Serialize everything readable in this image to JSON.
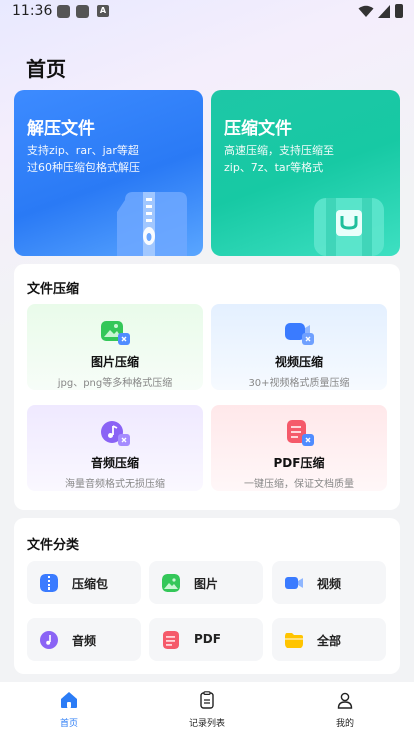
{
  "status_bar": {
    "time": "11:36",
    "notif_a": "A"
  },
  "page": {
    "title": "首页"
  },
  "hero_cards": [
    {
      "title": "解压文件",
      "desc_line1": "支持zip、rar、jar等超",
      "desc_line2": "过60种压缩包格式解压",
      "color": "#2a7af5"
    },
    {
      "title": "压缩文件",
      "desc_line1": "高速压缩，支持压缩至",
      "desc_line2": "zip、7z、tar等格式",
      "color": "#17c9a4"
    }
  ],
  "compress_section": {
    "title": "文件压缩",
    "tiles": [
      {
        "name": "图片压缩",
        "desc": "jpg、png等多种格式压缩",
        "icon": "image-compress-icon",
        "color": "#34c759"
      },
      {
        "name": "视频压缩",
        "desc": "30+视频格式质量压缩",
        "icon": "video-compress-icon",
        "color": "#3a7bff"
      },
      {
        "name": "音频压缩",
        "desc": "海量音频格式无损压缩",
        "icon": "audio-compress-icon",
        "color": "#8a63f5"
      },
      {
        "name": "PDF压缩",
        "desc": "一键压缩，保证文档质量",
        "icon": "pdf-compress-icon",
        "color": "#f55a6a"
      }
    ]
  },
  "category_section": {
    "title": "文件分类",
    "items": [
      {
        "label": "压缩包",
        "icon": "archive-icon",
        "color": "#3a7bff"
      },
      {
        "label": "图片",
        "icon": "image-icon",
        "color": "#34c759"
      },
      {
        "label": "视频",
        "icon": "video-icon",
        "color": "#3a7bff"
      },
      {
        "label": "音频",
        "icon": "audio-icon",
        "color": "#8a63f5"
      },
      {
        "label": "PDF",
        "icon": "pdf-icon",
        "color": "#f55a6a"
      },
      {
        "label": "全部",
        "icon": "folder-icon",
        "color": "#ffc400"
      }
    ]
  },
  "bottom_nav": {
    "active_color": "#2b7cf6",
    "items": [
      {
        "label": "首页",
        "icon": "home-icon",
        "active": true
      },
      {
        "label": "记录列表",
        "icon": "record-list-icon",
        "active": false
      },
      {
        "label": "我的",
        "icon": "profile-icon",
        "active": false
      }
    ]
  }
}
